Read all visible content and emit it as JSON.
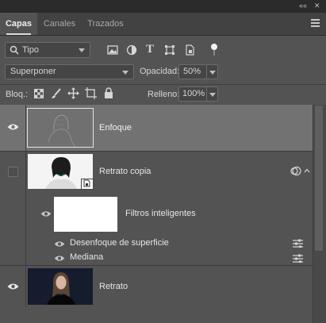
{
  "window": {
    "collapse_glyph": "««",
    "close_glyph": "✕"
  },
  "tabs": [
    {
      "label": "Capas",
      "active": true
    },
    {
      "label": "Canales",
      "active": false
    },
    {
      "label": "Trazados",
      "active": false
    }
  ],
  "panel_menu_icon": "hamburger-icon",
  "filter": {
    "kind_label": "Tipo",
    "icons": [
      "image-filter-icon",
      "adjustment-filter-icon",
      "type-filter-icon",
      "shape-filter-icon",
      "smart-object-filter-icon",
      "filter-toggle-icon"
    ]
  },
  "blend": {
    "mode": "Superponer",
    "opacity_label": "Opacidad:",
    "opacity_value": "50%"
  },
  "lock": {
    "label": "Bloq.:",
    "fill_label": "Relleno:",
    "fill_value": "100%",
    "icons": [
      "lock-transparent-icon",
      "lock-image-icon",
      "lock-position-icon",
      "lock-artboard-icon",
      "lock-all-icon"
    ]
  },
  "layers": [
    {
      "name": "Enfoque",
      "visible": true,
      "selected": true
    },
    {
      "name": "Retrato copia",
      "visible": false,
      "selected": false,
      "smart_object": true
    },
    {
      "name": "Filtros inteligentes",
      "visible": true,
      "is_mask": true
    },
    {
      "name": "Desenfoque de superficie",
      "visible": true,
      "is_filter": true
    },
    {
      "name": "Mediana",
      "visible": true,
      "is_filter": true
    },
    {
      "name": "Retrato",
      "visible": true,
      "selected": false
    }
  ],
  "colors": {
    "panel": "#535353",
    "selected_row": "#727272",
    "tab_bar": "#424242"
  }
}
